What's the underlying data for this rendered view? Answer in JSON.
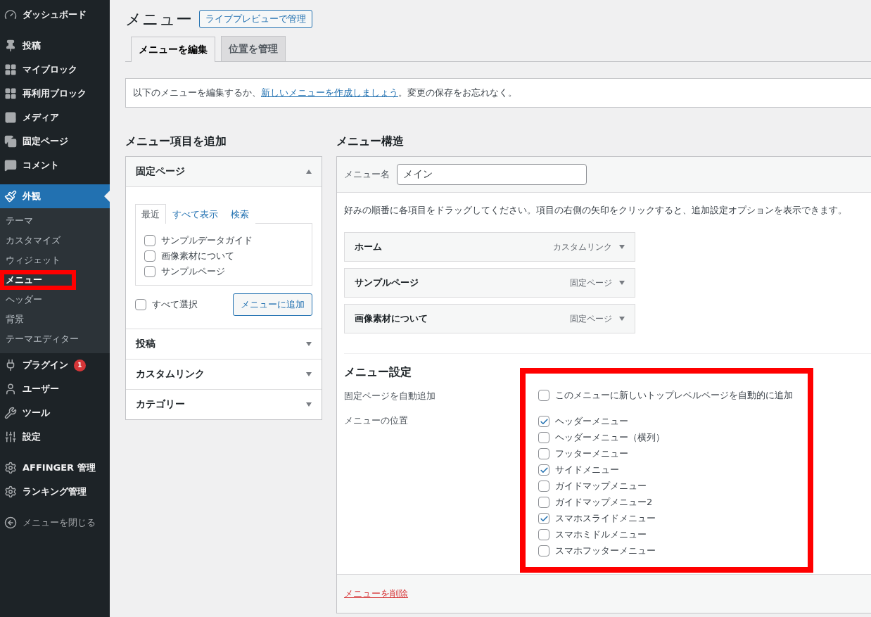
{
  "sidebar": {
    "groups": [
      [
        {
          "label": "ダッシュボード",
          "selected": false
        }
      ],
      [
        {
          "label": "投稿",
          "selected": false
        },
        {
          "label": "マイブロック",
          "selected": false
        },
        {
          "label": "再利用ブロック",
          "selected": false
        },
        {
          "label": "メディア",
          "selected": false
        },
        {
          "label": "固定ページ",
          "selected": false
        },
        {
          "label": "コメント",
          "selected": false
        }
      ],
      [
        {
          "label": "外観",
          "selected": true,
          "children": [
            {
              "label": "テーマ",
              "selected": false,
              "highlighted": false
            },
            {
              "label": "カスタマイズ",
              "selected": false,
              "highlighted": false
            },
            {
              "label": "ウィジェット",
              "selected": false,
              "highlighted": false
            },
            {
              "label": "メニュー",
              "selected": true,
              "highlighted": true
            },
            {
              "label": "ヘッダー",
              "selected": false,
              "highlighted": false
            },
            {
              "label": "背景",
              "selected": false,
              "highlighted": false
            },
            {
              "label": "テーマエディター",
              "selected": false,
              "highlighted": false
            }
          ]
        },
        {
          "label": "プラグイン",
          "selected": false,
          "badge": "1"
        },
        {
          "label": "ユーザー",
          "selected": false
        },
        {
          "label": "ツール",
          "selected": false
        },
        {
          "label": "設定",
          "selected": false
        }
      ],
      [
        {
          "label": "AFFINGER 管理",
          "selected": false
        },
        {
          "label": "ランキング管理",
          "selected": false
        }
      ],
      [
        {
          "label": "メニューを閉じる",
          "selected": false,
          "kind": "collapse"
        }
      ]
    ]
  },
  "title": "メニュー",
  "live_preview_button": "ライブプレビューで管理",
  "tabs": [
    {
      "label": "メニューを編集",
      "selected": true
    },
    {
      "label": "位置を管理",
      "selected": false
    }
  ],
  "notice": {
    "text_before": "以下のメニューを編集するか、",
    "link": "新しいメニューを作成しましょう",
    "text_after": "。変更の保存をお忘れなく。"
  },
  "add_items": {
    "heading": "メニュー項目を追加",
    "panels": [
      {
        "title": "固定ページ",
        "expanded": true,
        "tabs": [
          {
            "label": "最近",
            "selected": true
          },
          {
            "label": "すべて表示",
            "selected": false
          },
          {
            "label": "検索",
            "selected": false
          }
        ],
        "items": [
          {
            "label": "サンプルデータガイド",
            "checked": false
          },
          {
            "label": "画像素材について",
            "checked": false
          },
          {
            "label": "サンプルページ",
            "checked": false
          }
        ],
        "select_all": {
          "label": "すべて選択",
          "checked": false
        },
        "button": "メニューに追加"
      },
      {
        "title": "投稿",
        "expanded": false
      },
      {
        "title": "カスタムリンク",
        "expanded": false
      },
      {
        "title": "カテゴリー",
        "expanded": false
      }
    ]
  },
  "structure": {
    "heading": "メニュー構造",
    "name_label": "メニュー名",
    "name_value": "メイン",
    "instructions": "好みの順番に各項目をドラッグしてください。項目の右側の矢印をクリックすると、追加設定オプションを表示できます。",
    "items": [
      {
        "title": "ホーム",
        "type": "カスタムリンク"
      },
      {
        "title": "サンプルページ",
        "type": "固定ページ"
      },
      {
        "title": "画像素材について",
        "type": "固定ページ"
      }
    ],
    "settings": {
      "heading": "メニュー設定",
      "highlighted": true,
      "auto_add": {
        "label": "固定ページを自動追加",
        "option": {
          "label": "このメニューに新しいトップレベルページを自動的に追加",
          "checked": false
        }
      },
      "locations": {
        "label": "メニューの位置",
        "options": [
          {
            "label": "ヘッダーメニュー",
            "checked": true
          },
          {
            "label": "ヘッダーメニュー（横列）",
            "checked": false
          },
          {
            "label": "フッターメニュー",
            "checked": false
          },
          {
            "label": "サイドメニュー",
            "checked": true
          },
          {
            "label": "ガイドマップメニュー",
            "checked": false
          },
          {
            "label": "ガイドマップメニュー2",
            "checked": false
          },
          {
            "label": "スマホスライドメニュー",
            "checked": true
          },
          {
            "label": "スマホミドルメニュー",
            "checked": false
          },
          {
            "label": "スマホフッターメニュー",
            "checked": false
          }
        ]
      }
    },
    "delete_link": "メニューを削除"
  }
}
